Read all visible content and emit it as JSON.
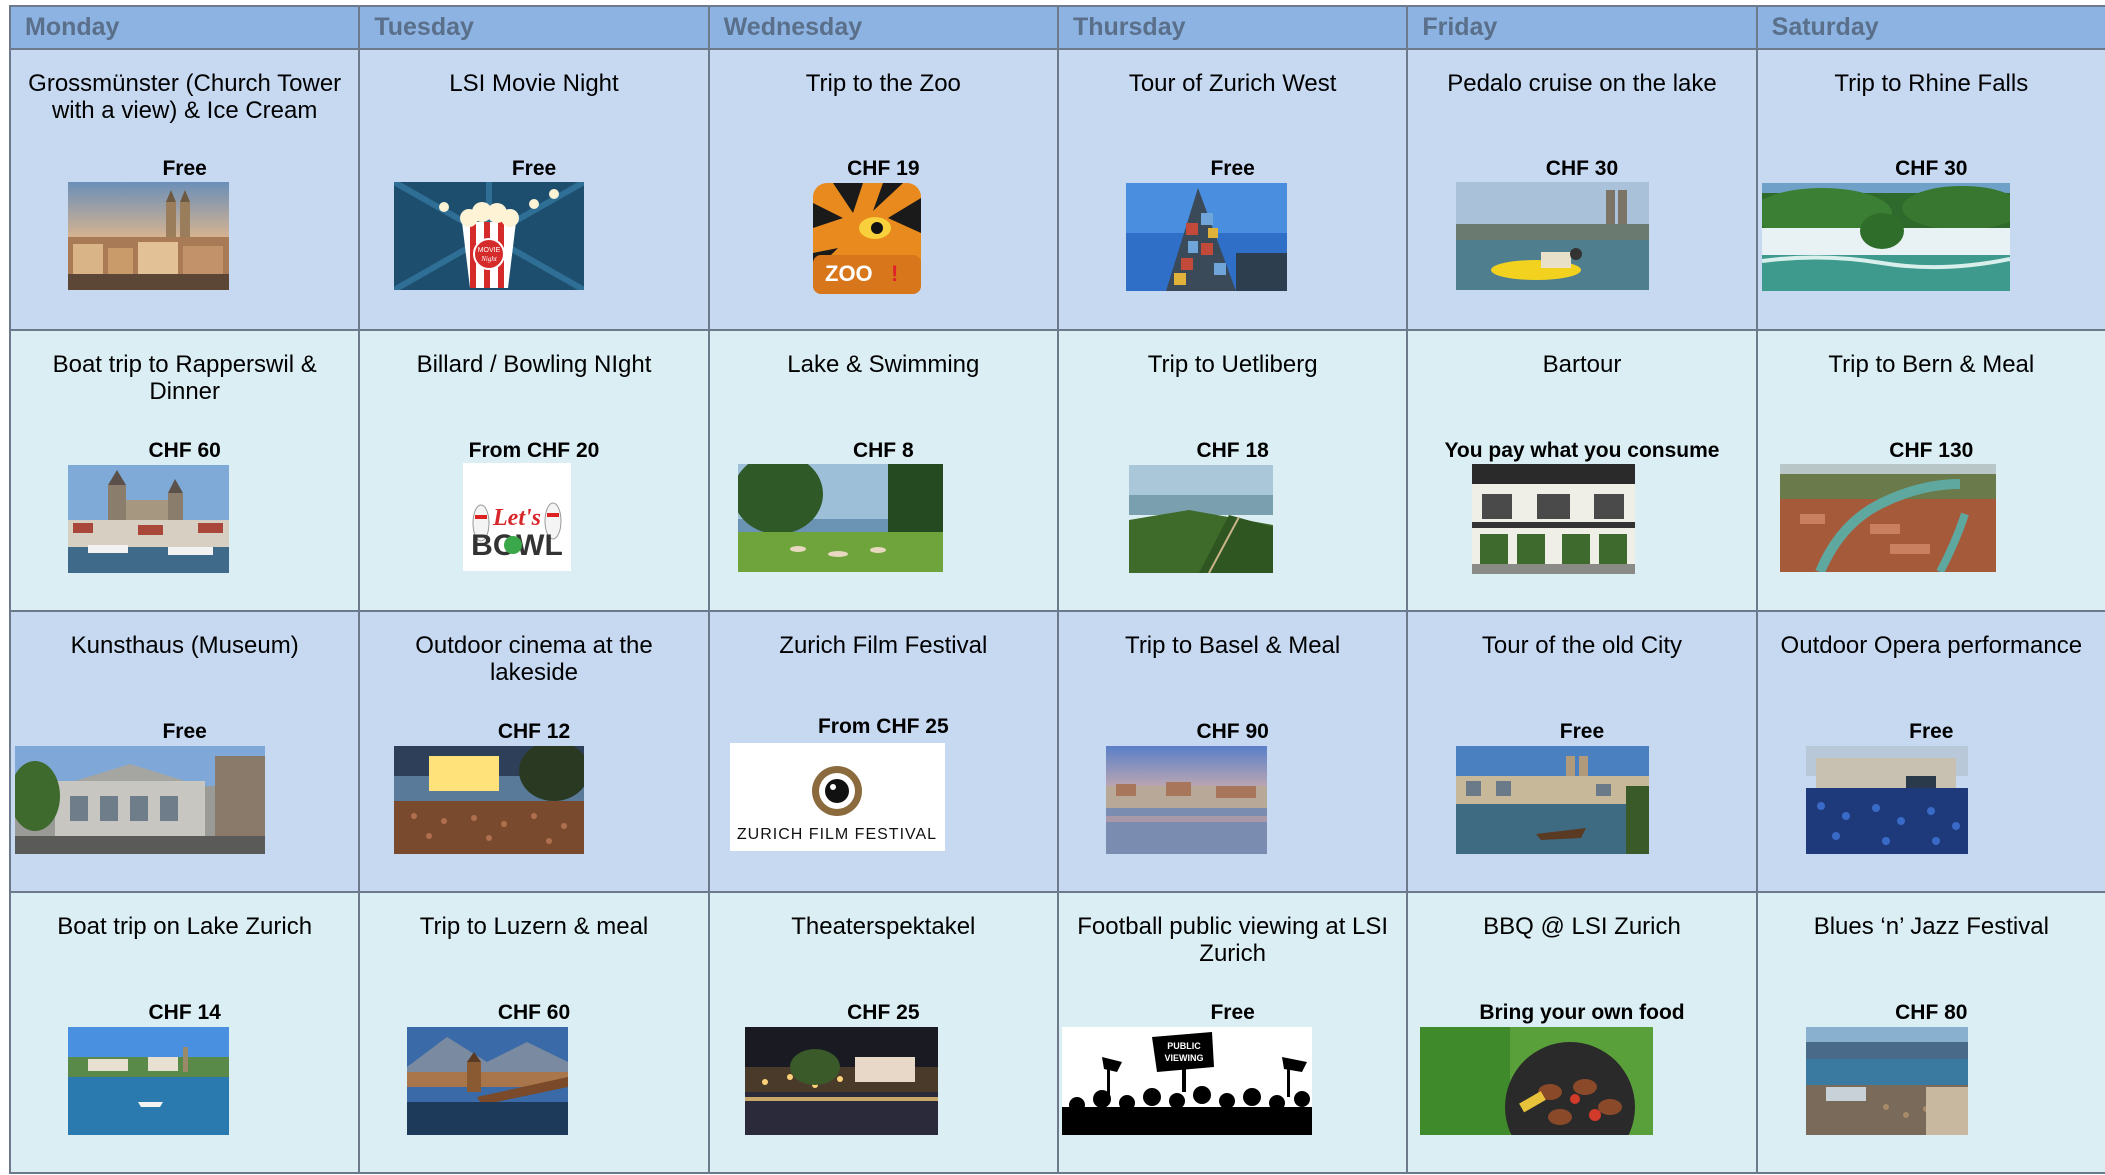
{
  "days": [
    "Monday",
    "Tuesday",
    "Wednesday",
    "Thursday",
    "Friday",
    "Saturday"
  ],
  "rows": [
    [
      {
        "title": "Grossmünster (Church Tower with a view) & Ice Cream",
        "price": "Free",
        "image": "grossmunster-cityscape"
      },
      {
        "title": "LSI Movie Night",
        "price": "Free",
        "image": "popcorn-movie-night",
        "image_text": "MOVIE Night"
      },
      {
        "title": "Trip to the Zoo",
        "price": "CHF 19",
        "image": "zoo-tiger-logo",
        "image_text": "ZOO"
      },
      {
        "title": "Tour of Zurich West",
        "price": "Free",
        "image": "glass-tower"
      },
      {
        "title": "Pedalo cruise on the lake",
        "price": "CHF 30",
        "image": "pedalo-lake"
      },
      {
        "title": "Trip to Rhine Falls",
        "price": "CHF 30",
        "image": "rhine-falls"
      }
    ],
    [
      {
        "title": "Boat trip to Rapperswil & Dinner",
        "price": "CHF 60",
        "image": "rapperswil-castle"
      },
      {
        "title": "Billard / Bowling NIght",
        "price": "From CHF 20",
        "image": "lets-bowl-logo",
        "image_text": "Let's BOWL"
      },
      {
        "title": "Lake & Swimming",
        "price": "CHF 8",
        "image": "lake-park"
      },
      {
        "title": "Trip to Uetliberg",
        "price": "CHF 18",
        "image": "uetliberg-hills"
      },
      {
        "title": "Bartour",
        "price": "You pay what you consume",
        "image": "pub-facade"
      },
      {
        "title": "Trip to Bern & Meal",
        "price": "CHF 130",
        "image": "bern-aerial"
      }
    ],
    [
      {
        "title": "Kunsthaus (Museum)",
        "price": "Free",
        "image": "kunsthaus-building"
      },
      {
        "title": "Outdoor cinema at the lakeside",
        "price": "CHF 12",
        "image": "outdoor-cinema"
      },
      {
        "title": "Zurich Film Festival",
        "price": "From CHF 25",
        "image": "film-festival-logo",
        "image_text": "ZURICH FILM FESTIVAL"
      },
      {
        "title": "Trip to Basel & Meal",
        "price": "CHF 90",
        "image": "basel-riverside"
      },
      {
        "title": "Tour of the old City",
        "price": "Free",
        "image": "old-city-river"
      },
      {
        "title": "Outdoor Opera performance",
        "price": "Free",
        "image": "opera-crowd"
      }
    ],
    [
      {
        "title": "Boat trip on Lake Zurich",
        "price": "CHF 14",
        "image": "lake-zurich-boat"
      },
      {
        "title": "Trip to Luzern & meal",
        "price": "CHF 60",
        "image": "luzern-bridge"
      },
      {
        "title": "Theaterspektakel",
        "price": "CHF 25",
        "image": "theater-night"
      },
      {
        "title": "Football public viewing at LSI Zurich",
        "price": "Free",
        "image": "public-viewing-crowd",
        "image_text": "PUBLIC VIEWING"
      },
      {
        "title": "BBQ @ LSI Zurich",
        "price": "Bring your own food",
        "image": "bbq-grill"
      },
      {
        "title": "Blues ‘n’ Jazz Festival",
        "price": "CHF 80",
        "image": "jazz-festival-lake"
      }
    ]
  ]
}
